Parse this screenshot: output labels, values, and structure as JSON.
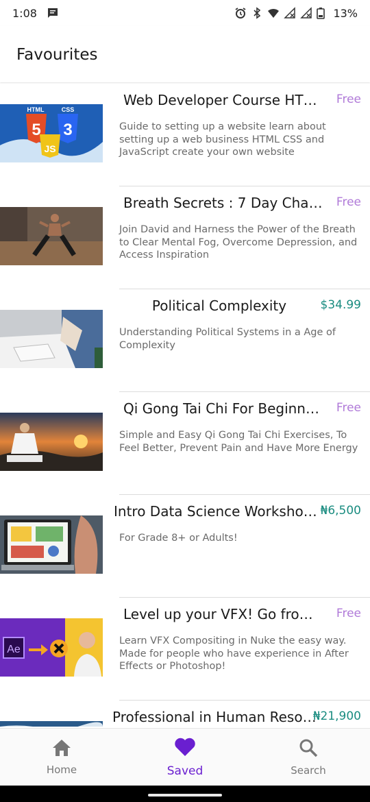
{
  "status_bar": {
    "time": "1:08",
    "battery": "13%"
  },
  "header": {
    "title": "Favourites"
  },
  "courses": [
    {
      "title": "Web Developer Course HTM...",
      "price": "Free",
      "description": "Guide to setting up a website learn about setting up a web business HTML CSS and JavaScript create your own website",
      "thumbnail_text": [
        "HTML",
        "CSS",
        "5",
        "3",
        "JS"
      ]
    },
    {
      "title": "Breath Secrets : 7 Day Challe...",
      "price": "Free",
      "description": "Join David and Harness the Power of the Breath to Clear Mental Fog, Overcome Depression, and Access Inspiration"
    },
    {
      "title": "Political Complexity",
      "price": "$34.99",
      "description": "Understanding Political Systems in a Age of Complexity"
    },
    {
      "title": "Qi Gong Tai Chi For Beginner...",
      "price": "Free",
      "description": "Simple and Easy Qi Gong Tai Chi Exercises, To Feel Better, Prevent Pain and Have More Energy"
    },
    {
      "title": "Intro Data Science Workshop...",
      "price": "₦6,500",
      "description": "For Grade 8+ or Adults!"
    },
    {
      "title": "Level up your VFX! Go from ...",
      "price": "Free",
      "description": "Learn VFX Compositing in Nuke the easy way. Made for people who have experience in After Effects or Photoshop!",
      "thumbnail_text": [
        "Ae"
      ]
    },
    {
      "title": "Professional in Human Resou...",
      "price": "₦21,900",
      "description": ""
    }
  ],
  "bottom_nav": {
    "items": [
      {
        "label": "Home",
        "icon": "home-icon"
      },
      {
        "label": "Saved",
        "icon": "heart-icon",
        "active": true
      },
      {
        "label": "Search",
        "icon": "search-icon"
      }
    ]
  },
  "colors": {
    "accent": "#6a1fd0",
    "free_price": "#b07ad8",
    "paid_price": "#1a8c80"
  }
}
